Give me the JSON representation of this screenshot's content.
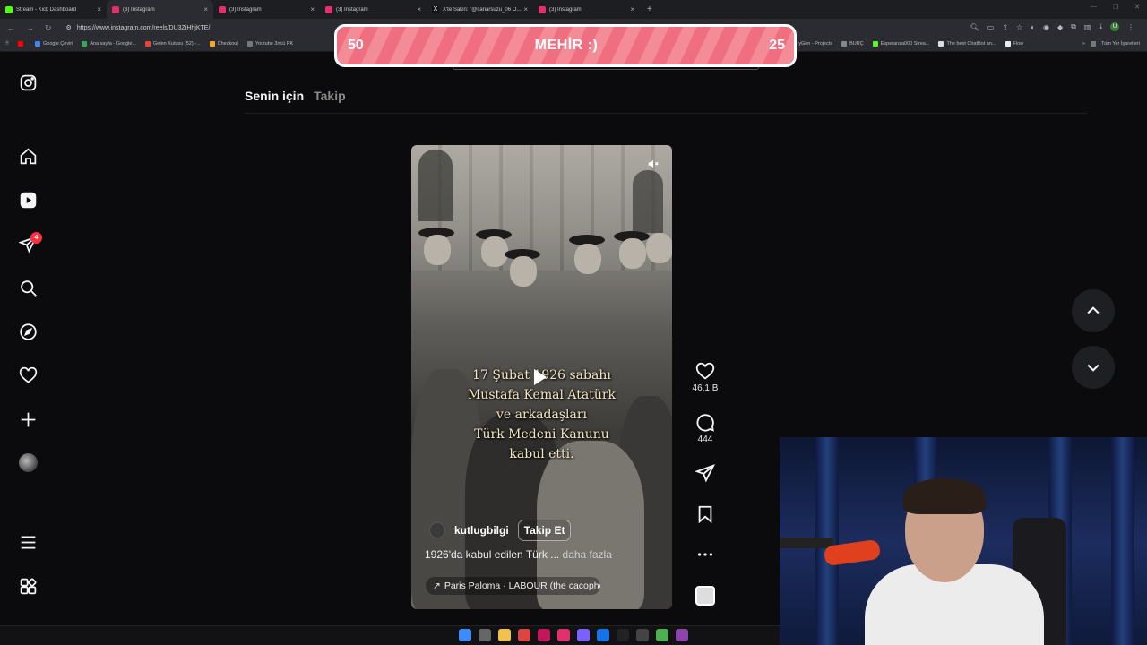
{
  "browser": {
    "tabs": [
      {
        "title": "Stream - Kick Dashboard",
        "color": "#53fc18"
      },
      {
        "title": "(3) Instagram",
        "color": "#e1306c",
        "active": true
      },
      {
        "title": "(3) Instagram",
        "color": "#e1306c"
      },
      {
        "title": "(3) Instagram",
        "color": "#e1306c"
      },
      {
        "title": "X'te Sakin: \"@canarsuzu_06 O...",
        "color": "#ffffff"
      },
      {
        "title": "(3) Instagram",
        "color": "#e1306c"
      }
    ],
    "url": "https://www.instagram.com/reels/DU3ZiHhjKTE/",
    "bookmarks": [
      "Google Çeviri",
      "Ana sayfa - Google...",
      "Gelen Kutusu (52) -...",
      "Checkout",
      "Youtube 3ncü PK"
    ],
    "bookmarks_right": [
      "lyGen - Projects",
      "BURÇ",
      "Esperanza000 Strea...",
      "The best ChatBot an...",
      "Flow"
    ],
    "bookmarks_all": "Tüm Yer İşaretleri"
  },
  "banner": {
    "left_number": "50",
    "title": "MEHİR :)",
    "right_number": "25"
  },
  "instagram": {
    "feed_tabs": {
      "for_you": "Senin için",
      "following": "Takip"
    },
    "notification_count": "4",
    "reel": {
      "caption_lines": [
        "17 Şubat 1926 sabahı",
        "Mustafa Kemal Atatürk",
        "ve arkadaşları",
        "Türk Medeni Kanunu",
        "kabul etti."
      ],
      "username": "kutlugbilgi",
      "follow_label": "Takip Et",
      "description": "1926'da kabul edilen Türk ...",
      "more_label": "daha fazla",
      "audio": "Paris Paloma · LABOUR (the cacopho"
    },
    "actions": {
      "likes": "46,1 B",
      "comments": "444"
    }
  }
}
